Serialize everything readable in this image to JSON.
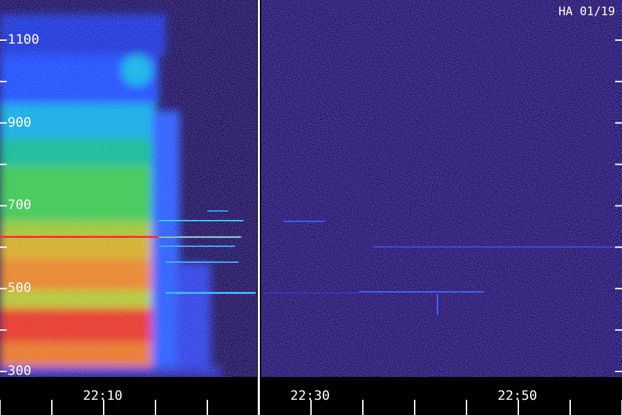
{
  "title": "HA 01/19",
  "chart_data": {
    "type": "heatmap",
    "title": "HA 01/19",
    "y_ticks": [
      300,
      500,
      700,
      900,
      1100
    ],
    "y_tick_labels": [
      "300",
      "500",
      "700",
      "900",
      "1100"
    ],
    "y_minor_ticks": [
      400,
      600,
      800,
      1000
    ],
    "ylim": [
      290,
      1180
    ],
    "x_tick_labels": [
      "22:10",
      "22:30",
      "22:50"
    ],
    "x_range_minutes": [
      "22:00",
      "23:00"
    ],
    "panels": 2,
    "colormap": [
      "#000000",
      "#1a0a66",
      "#2a1ad0",
      "#0a48ff",
      "#00a8ff",
      "#00e0c0",
      "#10e040",
      "#7ee020",
      "#e8e000",
      "#ffa000",
      "#ff4000",
      "#ff0000"
    ],
    "divider_color": "#ffffff",
    "background": "#000000"
  }
}
